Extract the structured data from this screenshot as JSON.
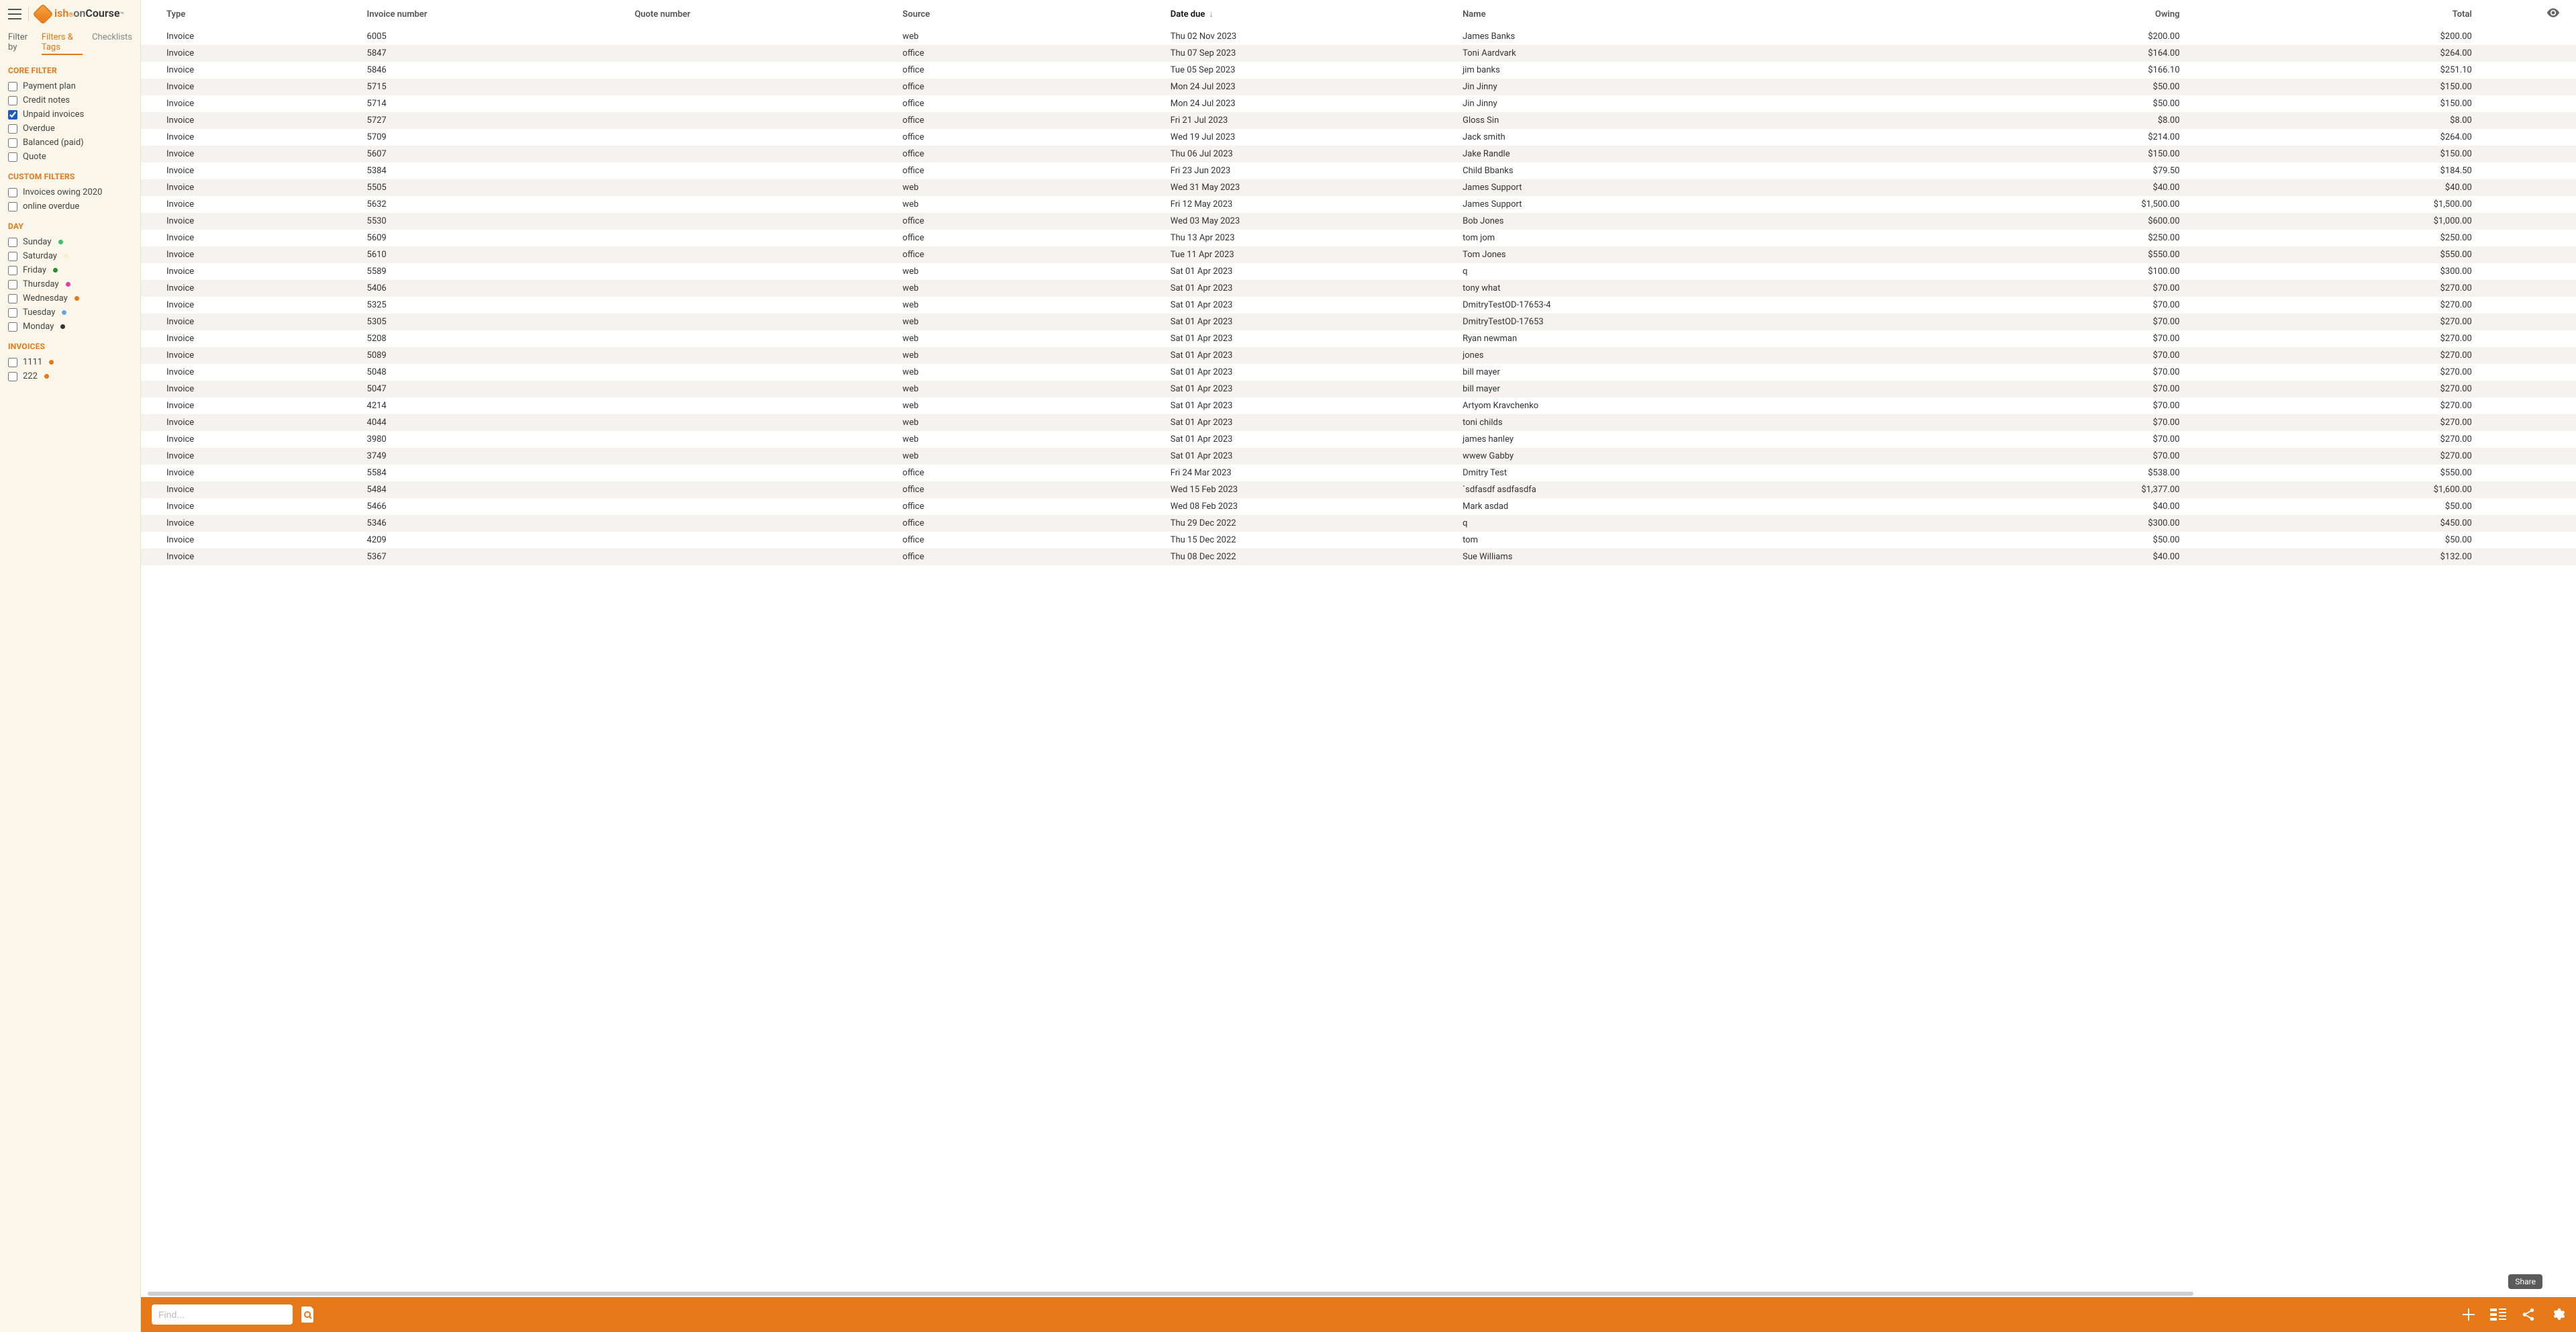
{
  "brand": {
    "ish": "ish",
    "on": "on",
    "course": "Course"
  },
  "filter_bar": {
    "label": "Filter by",
    "tabs": {
      "filters_tags": "Filters & Tags",
      "checklists": "Checklists"
    },
    "active": "filters_tags"
  },
  "sections": {
    "core_filter": {
      "title": "CORE FILTER",
      "items": [
        {
          "label": "Payment plan",
          "checked": false
        },
        {
          "label": "Credit notes",
          "checked": false
        },
        {
          "label": "Unpaid invoices",
          "checked": true
        },
        {
          "label": "Overdue",
          "checked": false
        },
        {
          "label": "Balanced (paid)",
          "checked": false
        },
        {
          "label": "Quote",
          "checked": false
        }
      ]
    },
    "custom_filters": {
      "title": "CUSTOM FILTERS",
      "items": [
        {
          "label": "Invoices owing 2020",
          "checked": false
        },
        {
          "label": "online overdue",
          "checked": false
        }
      ]
    },
    "day": {
      "title": "DAY",
      "items": [
        {
          "label": "Sunday",
          "checked": false,
          "dot": "#3cc06a"
        },
        {
          "label": "Saturday",
          "checked": false,
          "dot": "#f5efc1"
        },
        {
          "label": "Friday",
          "checked": false,
          "dot": "#2e8b2e"
        },
        {
          "label": "Thursday",
          "checked": false,
          "dot": "#e33fb0"
        },
        {
          "label": "Wednesday",
          "checked": false,
          "dot": "#e77817"
        },
        {
          "label": "Tuesday",
          "checked": false,
          "dot": "#6aa6e6"
        },
        {
          "label": "Monday",
          "checked": false,
          "dot": "#333333"
        }
      ]
    },
    "invoices": {
      "title": "INVOICES",
      "items": [
        {
          "label": "1111",
          "checked": false,
          "dot": "#e77817"
        },
        {
          "label": "222",
          "checked": false,
          "dot": "#e77817"
        }
      ]
    }
  },
  "columns": {
    "type": "Type",
    "invoice_number": "Invoice number",
    "quote_number": "Quote number",
    "source": "Source",
    "date_due": "Date due",
    "name": "Name",
    "owing": "Owing",
    "total": "Total"
  },
  "sort": {
    "column": "date_due",
    "dir": "desc"
  },
  "rows": [
    {
      "type": "Invoice",
      "invoice": "6005",
      "quote": "",
      "source": "web",
      "due": "Thu 02 Nov 2023",
      "name": "James Banks",
      "owing": "$200.00",
      "total": "$200.00"
    },
    {
      "type": "Invoice",
      "invoice": "5847",
      "quote": "",
      "source": "office",
      "due": "Thu 07 Sep 2023",
      "name": "Toni Aardvark",
      "owing": "$164.00",
      "total": "$264.00"
    },
    {
      "type": "Invoice",
      "invoice": "5846",
      "quote": "",
      "source": "office",
      "due": "Tue 05 Sep 2023",
      "name": "jim banks",
      "owing": "$166.10",
      "total": "$251.10"
    },
    {
      "type": "Invoice",
      "invoice": "5715",
      "quote": "",
      "source": "office",
      "due": "Mon 24 Jul 2023",
      "name": "Jin Jinny",
      "owing": "$50.00",
      "total": "$150.00"
    },
    {
      "type": "Invoice",
      "invoice": "5714",
      "quote": "",
      "source": "office",
      "due": "Mon 24 Jul 2023",
      "name": "Jin Jinny",
      "owing": "$50.00",
      "total": "$150.00"
    },
    {
      "type": "Invoice",
      "invoice": "5727",
      "quote": "",
      "source": "office",
      "due": "Fri 21 Jul 2023",
      "name": "Gloss Sin",
      "owing": "$8.00",
      "total": "$8.00"
    },
    {
      "type": "Invoice",
      "invoice": "5709",
      "quote": "",
      "source": "office",
      "due": "Wed 19 Jul 2023",
      "name": "Jack smith",
      "owing": "$214.00",
      "total": "$264.00"
    },
    {
      "type": "Invoice",
      "invoice": "5607",
      "quote": "",
      "source": "office",
      "due": "Thu 06 Jul 2023",
      "name": "Jake Randle",
      "owing": "$150.00",
      "total": "$150.00"
    },
    {
      "type": "Invoice",
      "invoice": "5384",
      "quote": "",
      "source": "office",
      "due": "Fri 23 Jun 2023",
      "name": "Child Bbanks",
      "owing": "$79.50",
      "total": "$184.50"
    },
    {
      "type": "Invoice",
      "invoice": "5505",
      "quote": "",
      "source": "web",
      "due": "Wed 31 May 2023",
      "name": "James Support",
      "owing": "$40.00",
      "total": "$40.00"
    },
    {
      "type": "Invoice",
      "invoice": "5632",
      "quote": "",
      "source": "web",
      "due": "Fri 12 May 2023",
      "name": "James Support",
      "owing": "$1,500.00",
      "total": "$1,500.00"
    },
    {
      "type": "Invoice",
      "invoice": "5530",
      "quote": "",
      "source": "office",
      "due": "Wed 03 May 2023",
      "name": "Bob Jones",
      "owing": "$600.00",
      "total": "$1,000.00"
    },
    {
      "type": "Invoice",
      "invoice": "5609",
      "quote": "",
      "source": "office",
      "due": "Thu 13 Apr 2023",
      "name": "tom jom",
      "owing": "$250.00",
      "total": "$250.00"
    },
    {
      "type": "Invoice",
      "invoice": "5610",
      "quote": "",
      "source": "office",
      "due": "Tue 11 Apr 2023",
      "name": "Tom Jones",
      "owing": "$550.00",
      "total": "$550.00"
    },
    {
      "type": "Invoice",
      "invoice": "5589",
      "quote": "",
      "source": "web",
      "due": "Sat 01 Apr 2023",
      "name": "q",
      "owing": "$100.00",
      "total": "$300.00"
    },
    {
      "type": "Invoice",
      "invoice": "5406",
      "quote": "",
      "source": "web",
      "due": "Sat 01 Apr 2023",
      "name": "tony what",
      "owing": "$70.00",
      "total": "$270.00"
    },
    {
      "type": "Invoice",
      "invoice": "5325",
      "quote": "",
      "source": "web",
      "due": "Sat 01 Apr 2023",
      "name": "DmitryTestOD-17653-4",
      "owing": "$70.00",
      "total": "$270.00"
    },
    {
      "type": "Invoice",
      "invoice": "5305",
      "quote": "",
      "source": "web",
      "due": "Sat 01 Apr 2023",
      "name": "DmitryTestOD-17653",
      "owing": "$70.00",
      "total": "$270.00"
    },
    {
      "type": "Invoice",
      "invoice": "5208",
      "quote": "",
      "source": "web",
      "due": "Sat 01 Apr 2023",
      "name": "Ryan newman",
      "owing": "$70.00",
      "total": "$270.00"
    },
    {
      "type": "Invoice",
      "invoice": "5089",
      "quote": "",
      "source": "web",
      "due": "Sat 01 Apr 2023",
      "name": "jones",
      "owing": "$70.00",
      "total": "$270.00"
    },
    {
      "type": "Invoice",
      "invoice": "5048",
      "quote": "",
      "source": "web",
      "due": "Sat 01 Apr 2023",
      "name": "bill mayer",
      "owing": "$70.00",
      "total": "$270.00"
    },
    {
      "type": "Invoice",
      "invoice": "5047",
      "quote": "",
      "source": "web",
      "due": "Sat 01 Apr 2023",
      "name": "bill mayer",
      "owing": "$70.00",
      "total": "$270.00"
    },
    {
      "type": "Invoice",
      "invoice": "4214",
      "quote": "",
      "source": "web",
      "due": "Sat 01 Apr 2023",
      "name": "Artyom Kravchenko",
      "owing": "$70.00",
      "total": "$270.00"
    },
    {
      "type": "Invoice",
      "invoice": "4044",
      "quote": "",
      "source": "web",
      "due": "Sat 01 Apr 2023",
      "name": "toni childs",
      "owing": "$70.00",
      "total": "$270.00"
    },
    {
      "type": "Invoice",
      "invoice": "3980",
      "quote": "",
      "source": "web",
      "due": "Sat 01 Apr 2023",
      "name": "james hanley",
      "owing": "$70.00",
      "total": "$270.00"
    },
    {
      "type": "Invoice",
      "invoice": "3749",
      "quote": "",
      "source": "web",
      "due": "Sat 01 Apr 2023",
      "name": "wwew Gabby",
      "owing": "$70.00",
      "total": "$270.00"
    },
    {
      "type": "Invoice",
      "invoice": "5584",
      "quote": "",
      "source": "office",
      "due": "Fri 24 Mar 2023",
      "name": "Dmitry Test",
      "owing": "$538.00",
      "total": "$550.00"
    },
    {
      "type": "Invoice",
      "invoice": "5484",
      "quote": "",
      "source": "office",
      "due": "Wed 15 Feb 2023",
      "name": "`sdfasdf asdfasdfa",
      "owing": "$1,377.00",
      "total": "$1,600.00"
    },
    {
      "type": "Invoice",
      "invoice": "5466",
      "quote": "",
      "source": "office",
      "due": "Wed 08 Feb 2023",
      "name": "Mark asdad",
      "owing": "$40.00",
      "total": "$50.00"
    },
    {
      "type": "Invoice",
      "invoice": "5346",
      "quote": "",
      "source": "office",
      "due": "Thu 29 Dec 2022",
      "name": "q",
      "owing": "$300.00",
      "total": "$450.00"
    },
    {
      "type": "Invoice",
      "invoice": "4209",
      "quote": "",
      "source": "office",
      "due": "Thu 15 Dec 2022",
      "name": "tom",
      "owing": "$50.00",
      "total": "$50.00"
    },
    {
      "type": "Invoice",
      "invoice": "5367",
      "quote": "",
      "source": "office",
      "due": "Thu 08 Dec 2022",
      "name": "Sue Williams",
      "owing": "$40.00",
      "total": "$132.00"
    }
  ],
  "bottom": {
    "search_placeholder": "Find...",
    "share_tooltip": "Share"
  }
}
